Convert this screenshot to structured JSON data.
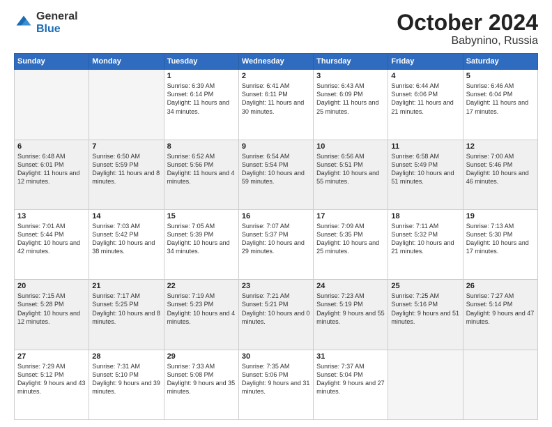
{
  "header": {
    "logo_general": "General",
    "logo_blue": "Blue",
    "month": "October 2024",
    "location": "Babynino, Russia"
  },
  "weekdays": [
    "Sunday",
    "Monday",
    "Tuesday",
    "Wednesday",
    "Thursday",
    "Friday",
    "Saturday"
  ],
  "weeks": [
    [
      {
        "day": "",
        "info": ""
      },
      {
        "day": "",
        "info": ""
      },
      {
        "day": "1",
        "info": "Sunrise: 6:39 AM\nSunset: 6:14 PM\nDaylight: 11 hours\nand 34 minutes."
      },
      {
        "day": "2",
        "info": "Sunrise: 6:41 AM\nSunset: 6:11 PM\nDaylight: 11 hours\nand 30 minutes."
      },
      {
        "day": "3",
        "info": "Sunrise: 6:43 AM\nSunset: 6:09 PM\nDaylight: 11 hours\nand 25 minutes."
      },
      {
        "day": "4",
        "info": "Sunrise: 6:44 AM\nSunset: 6:06 PM\nDaylight: 11 hours\nand 21 minutes."
      },
      {
        "day": "5",
        "info": "Sunrise: 6:46 AM\nSunset: 6:04 PM\nDaylight: 11 hours\nand 17 minutes."
      }
    ],
    [
      {
        "day": "6",
        "info": "Sunrise: 6:48 AM\nSunset: 6:01 PM\nDaylight: 11 hours\nand 12 minutes."
      },
      {
        "day": "7",
        "info": "Sunrise: 6:50 AM\nSunset: 5:59 PM\nDaylight: 11 hours\nand 8 minutes."
      },
      {
        "day": "8",
        "info": "Sunrise: 6:52 AM\nSunset: 5:56 PM\nDaylight: 11 hours\nand 4 minutes."
      },
      {
        "day": "9",
        "info": "Sunrise: 6:54 AM\nSunset: 5:54 PM\nDaylight: 10 hours\nand 59 minutes."
      },
      {
        "day": "10",
        "info": "Sunrise: 6:56 AM\nSunset: 5:51 PM\nDaylight: 10 hours\nand 55 minutes."
      },
      {
        "day": "11",
        "info": "Sunrise: 6:58 AM\nSunset: 5:49 PM\nDaylight: 10 hours\nand 51 minutes."
      },
      {
        "day": "12",
        "info": "Sunrise: 7:00 AM\nSunset: 5:46 PM\nDaylight: 10 hours\nand 46 minutes."
      }
    ],
    [
      {
        "day": "13",
        "info": "Sunrise: 7:01 AM\nSunset: 5:44 PM\nDaylight: 10 hours\nand 42 minutes."
      },
      {
        "day": "14",
        "info": "Sunrise: 7:03 AM\nSunset: 5:42 PM\nDaylight: 10 hours\nand 38 minutes."
      },
      {
        "day": "15",
        "info": "Sunrise: 7:05 AM\nSunset: 5:39 PM\nDaylight: 10 hours\nand 34 minutes."
      },
      {
        "day": "16",
        "info": "Sunrise: 7:07 AM\nSunset: 5:37 PM\nDaylight: 10 hours\nand 29 minutes."
      },
      {
        "day": "17",
        "info": "Sunrise: 7:09 AM\nSunset: 5:35 PM\nDaylight: 10 hours\nand 25 minutes."
      },
      {
        "day": "18",
        "info": "Sunrise: 7:11 AM\nSunset: 5:32 PM\nDaylight: 10 hours\nand 21 minutes."
      },
      {
        "day": "19",
        "info": "Sunrise: 7:13 AM\nSunset: 5:30 PM\nDaylight: 10 hours\nand 17 minutes."
      }
    ],
    [
      {
        "day": "20",
        "info": "Sunrise: 7:15 AM\nSunset: 5:28 PM\nDaylight: 10 hours\nand 12 minutes."
      },
      {
        "day": "21",
        "info": "Sunrise: 7:17 AM\nSunset: 5:25 PM\nDaylight: 10 hours\nand 8 minutes."
      },
      {
        "day": "22",
        "info": "Sunrise: 7:19 AM\nSunset: 5:23 PM\nDaylight: 10 hours\nand 4 minutes."
      },
      {
        "day": "23",
        "info": "Sunrise: 7:21 AM\nSunset: 5:21 PM\nDaylight: 10 hours\nand 0 minutes."
      },
      {
        "day": "24",
        "info": "Sunrise: 7:23 AM\nSunset: 5:19 PM\nDaylight: 9 hours\nand 55 minutes."
      },
      {
        "day": "25",
        "info": "Sunrise: 7:25 AM\nSunset: 5:16 PM\nDaylight: 9 hours\nand 51 minutes."
      },
      {
        "day": "26",
        "info": "Sunrise: 7:27 AM\nSunset: 5:14 PM\nDaylight: 9 hours\nand 47 minutes."
      }
    ],
    [
      {
        "day": "27",
        "info": "Sunrise: 7:29 AM\nSunset: 5:12 PM\nDaylight: 9 hours\nand 43 minutes."
      },
      {
        "day": "28",
        "info": "Sunrise: 7:31 AM\nSunset: 5:10 PM\nDaylight: 9 hours\nand 39 minutes."
      },
      {
        "day": "29",
        "info": "Sunrise: 7:33 AM\nSunset: 5:08 PM\nDaylight: 9 hours\nand 35 minutes."
      },
      {
        "day": "30",
        "info": "Sunrise: 7:35 AM\nSunset: 5:06 PM\nDaylight: 9 hours\nand 31 minutes."
      },
      {
        "day": "31",
        "info": "Sunrise: 7:37 AM\nSunset: 5:04 PM\nDaylight: 9 hours\nand 27 minutes."
      },
      {
        "day": "",
        "info": ""
      },
      {
        "day": "",
        "info": ""
      }
    ]
  ]
}
